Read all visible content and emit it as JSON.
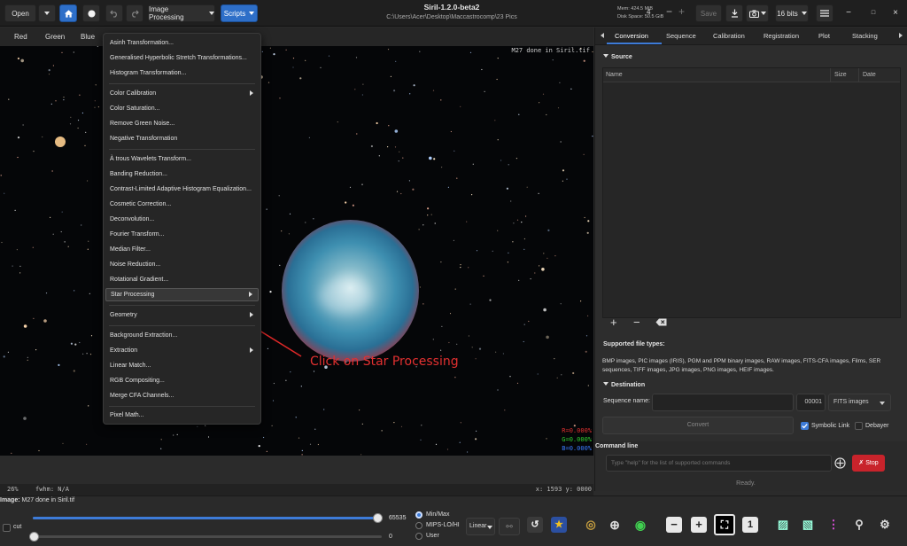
{
  "header": {
    "open_label": "Open",
    "image_processing_label": "Image Processing",
    "scripts_label": "Scripts",
    "title": "Siril-1.2.0-beta2",
    "path": "C:\\Users\\Acer\\Desktop\\Maccastrocomp\\23 Pics",
    "mem": "Mem: 424.5 MiB",
    "disk": "Disk Space: 50.5 GiB",
    "threads": "4",
    "save_label": "Save",
    "bits_label": "16 bits"
  },
  "channels": [
    "Red",
    "Green",
    "Blue"
  ],
  "viewport": {
    "caption": "M27 done in Siril.tif",
    "annotation": "Click on Star Processing",
    "readout_r": "R=0.000%",
    "readout_g": "G=0.000%",
    "readout_b": "B=0.000%"
  },
  "menu": {
    "items": [
      "Asinh Transformation...",
      "Generalised Hyperbolic Stretch Transformations...",
      "Histogram Transformation...",
      "Color Calibration",
      "Color Saturation...",
      "Remove Green Noise...",
      "Negative Transformation",
      "À trous Wavelets Transform...",
      "Banding Reduction...",
      "Contrast-Limited Adaptive Histogram Equalization...",
      "Cosmetic Correction...",
      "Deconvolution...",
      "Fourier Transform...",
      "Median Filter...",
      "Noise Reduction...",
      "Rotational Gradient...",
      "Star Processing",
      "Geometry",
      "Background Extraction...",
      "Extraction",
      "Linear Match...",
      "RGB Compositing...",
      "Merge CFA Channels...",
      "Pixel Math..."
    ]
  },
  "image_status": {
    "zoom": "26%",
    "fwhm": "fwhm: N/A",
    "coords": "x: 1593 y: 0000"
  },
  "panel": {
    "tabs": [
      "Conversion",
      "Sequence",
      "Calibration",
      "Registration",
      "Plot",
      "Stacking"
    ],
    "source_title": "Source",
    "col_name": "Name",
    "col_size": "Size",
    "col_date": "Date",
    "supported_title": "Supported file types:",
    "supported_text": "BMP images, PIC images (IRIS), PGM and PPM binary images, RAW images, FITS-CFA images, Films, SER sequences, TIFF images, JPG images, PNG images, HEIF images.",
    "destination_title": "Destination",
    "seq_label": "Sequence name:",
    "seq_index": "00001",
    "format": "FITS images",
    "convert_label": "Convert",
    "symbolic_label": "Symbolic Link",
    "debayer_label": "Debayer",
    "command_title": "Command line",
    "command_placeholder": "Type \"help\" for the list of supported commands",
    "stop_label": "Stop",
    "ready": "Ready."
  },
  "bottom": {
    "image_prefix": "Image:",
    "image_name": "M27 done in Siril.tif",
    "cut_label": "cut",
    "max_value": "65535",
    "min_value": "0",
    "modes": [
      "Min/Max",
      "MIPS-LO/HI",
      "User"
    ],
    "scale": "Linear"
  }
}
